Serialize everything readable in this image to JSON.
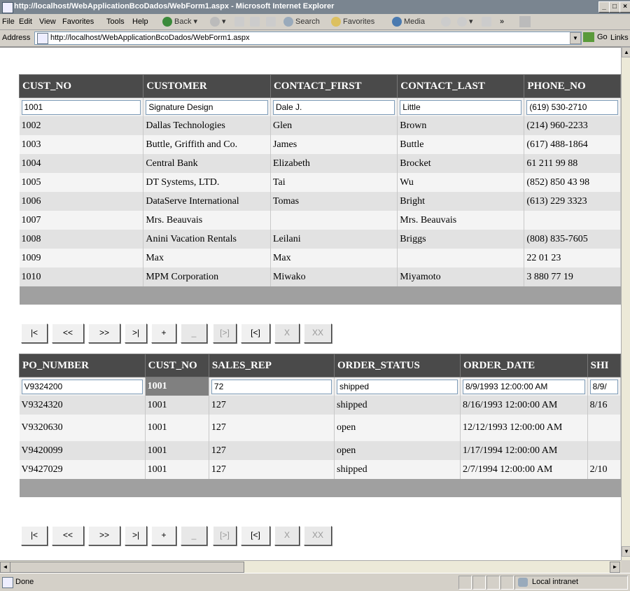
{
  "window": {
    "title": "http://localhost/WebApplicationBcoDados/WebForm1.aspx - Microsoft Internet Explorer",
    "minimize": "_",
    "maximize": "□",
    "close": "×"
  },
  "menu": [
    "File",
    "Edit",
    "View",
    "Favorites",
    "Tools",
    "Help"
  ],
  "toolbar": {
    "back": "Back",
    "search": "Search",
    "favorites": "Favorites",
    "media": "Media",
    "more": "»"
  },
  "address": {
    "label": "Address",
    "url": "http://localhost/WebApplicationBcoDados/WebForm1.aspx",
    "go": "Go",
    "links": "Links"
  },
  "customers": {
    "headers": [
      "CUST_NO",
      "CUSTOMER",
      "CONTACT_FIRST",
      "CONTACT_LAST",
      "PHONE_NO"
    ],
    "edit_row": [
      "1001",
      "Signature Design",
      "Dale J.",
      "Little",
      "(619) 530-2710"
    ],
    "rows": [
      [
        "1002",
        "Dallas Technologies",
        "Glen",
        "Brown",
        "(214) 960-2233"
      ],
      [
        "1003",
        "Buttle, Griffith and Co.",
        "James",
        "Buttle",
        "(617) 488-1864"
      ],
      [
        "1004",
        "Central Bank",
        "Elizabeth",
        "Brocket",
        "61 211 99 88"
      ],
      [
        "1005",
        "DT Systems, LTD.",
        "Tai",
        "Wu",
        "(852) 850 43 98"
      ],
      [
        "1006",
        "DataServe International",
        "Tomas",
        "Bright",
        "(613) 229 3323"
      ],
      [
        "1007",
        "Mrs. Beauvais",
        "",
        "Mrs. Beauvais",
        ""
      ],
      [
        "1008",
        "Anini Vacation Rentals",
        "Leilani",
        "Briggs",
        "(808) 835-7605"
      ],
      [
        "1009",
        "Max",
        "Max",
        "",
        "22 01 23"
      ],
      [
        "1010",
        "MPM Corporation",
        "Miwako",
        "Miyamoto",
        "3 880 77 19"
      ]
    ]
  },
  "orders": {
    "headers": [
      "PO_NUMBER",
      "CUST_NO",
      "SALES_REP",
      "ORDER_STATUS",
      "ORDER_DATE",
      "SHI"
    ],
    "edit_row": [
      "V9324200",
      "1001",
      "72",
      "shipped",
      "8/9/1993 12:00:00 AM",
      "8/9/"
    ],
    "rows": [
      [
        "V9324320",
        "1001",
        "127",
        "shipped",
        "8/16/1993 12:00:00 AM",
        "8/16"
      ],
      [
        "V9320630",
        "1001",
        "127",
        "open",
        "12/12/1993 12:00:00 AM",
        ""
      ],
      [
        "V9420099",
        "1001",
        "127",
        "open",
        "1/17/1994 12:00:00 AM",
        ""
      ],
      [
        "V9427029",
        "1001",
        "127",
        "shipped",
        "2/7/1994 12:00:00 AM",
        "2/10"
      ]
    ]
  },
  "nav_buttons": [
    "|<",
    "<<",
    ">>",
    ">|",
    "+",
    "_",
    "[>]",
    "[<]",
    "X",
    "XX"
  ],
  "status": {
    "text": "Done",
    "zone": "Local intranet"
  },
  "scroll": {
    "left": "◄",
    "right": "►",
    "up": "▲",
    "down": "▼"
  }
}
